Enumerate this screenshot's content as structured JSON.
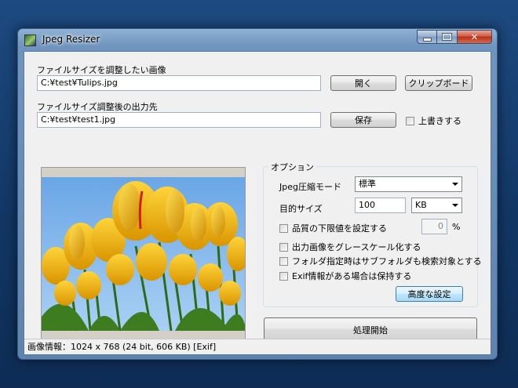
{
  "window": {
    "title": "Jpeg Resizer"
  },
  "input": {
    "label": "ファイルサイズを調整したい画像",
    "path": "C:¥test¥Tulips.jpg",
    "open_button": "開く",
    "clipboard_button": "クリップボード"
  },
  "output": {
    "label": "ファイルサイズ調整後の出力先",
    "path": "C:¥test¥test1.jpg",
    "save_button": "保存",
    "overwrite_label": "上書きする"
  },
  "options": {
    "legend": "オプション",
    "mode_label": "Jpeg圧縮モード",
    "mode_value": "標準",
    "target_label": "目的サイズ",
    "target_value": "100",
    "unit_value": "KB",
    "quality_label": "品質の下限値を設定する",
    "quality_value": "0",
    "quality_unit": "%",
    "grayscale_label": "出力画像をグレースケール化する",
    "subfolder_label": "フォルダ指定時はサブフォルダも検索対象とする",
    "exif_label": "Exif情報がある場合は保持する",
    "advanced_button": "高度な設定"
  },
  "process_button": "処理開始",
  "status": {
    "text": "画像情報：1024 x 768 (24 bit, 606 KB) [Exif]"
  }
}
